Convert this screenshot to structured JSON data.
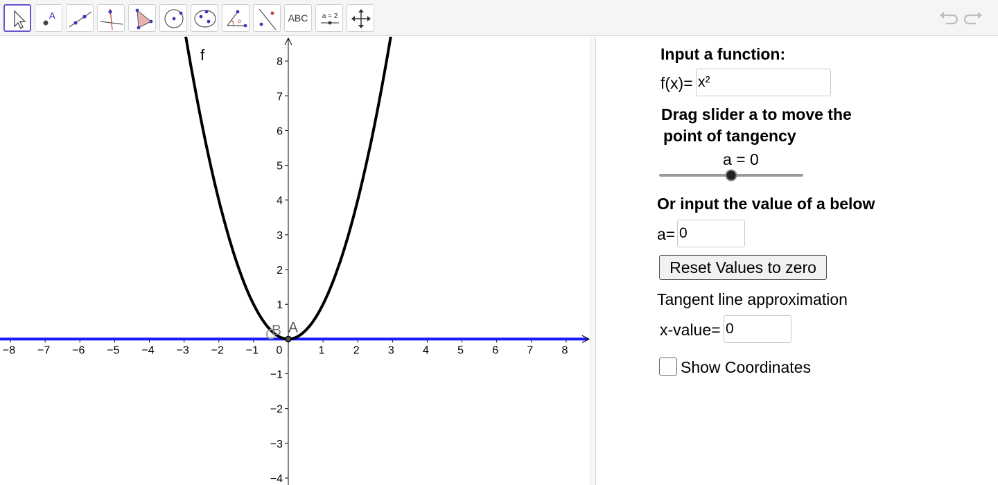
{
  "toolbar": {
    "tools": [
      {
        "name": "move-tool"
      },
      {
        "name": "point-tool",
        "glyph_label": "A"
      },
      {
        "name": "line-tool"
      },
      {
        "name": "perpendicular-line-tool"
      },
      {
        "name": "polygon-tool"
      },
      {
        "name": "circle-with-center-tool"
      },
      {
        "name": "ellipse-tool"
      },
      {
        "name": "angle-tool",
        "glyph_label": "α"
      },
      {
        "name": "reflect-tool"
      },
      {
        "name": "text-tool",
        "label": "ABC"
      },
      {
        "name": "slider-tool",
        "label": "a = 2"
      },
      {
        "name": "move-graphics-view-tool"
      }
    ],
    "undo_icon": "undo-icon",
    "redo_icon": "redo-icon"
  },
  "graph": {
    "function_label": "f",
    "point_labels": [
      "A",
      "B",
      "C"
    ],
    "x_ticks": [
      "−8",
      "−7",
      "−6",
      "−5",
      "−4",
      "−3",
      "−2",
      "−1",
      "0",
      "1",
      "2",
      "3",
      "4",
      "5",
      "6",
      "7",
      "8"
    ],
    "y_ticks": [
      "8",
      "7",
      "6",
      "5",
      "4",
      "3",
      "2",
      "1",
      "−1",
      "−2",
      "−3",
      "−4"
    ],
    "colors": {
      "curve": "#000000",
      "tangent": "#1a1aff",
      "axes": "#000000"
    }
  },
  "chart_data": {
    "type": "line",
    "title": "",
    "xlabel": "",
    "ylabel": "",
    "xlim": [
      -8.3,
      8.7
    ],
    "ylim": [
      -4.2,
      8.7
    ],
    "grid": false,
    "series": [
      {
        "name": "f",
        "function": "x²",
        "x": [
          -3,
          -2,
          -1,
          0,
          1,
          2,
          3
        ],
        "y": [
          9,
          4,
          1,
          0,
          1,
          4,
          9
        ]
      },
      {
        "name": "",
        "function": "y = 0",
        "x": [
          -8.3,
          8.7
        ],
        "y": [
          0,
          0
        ]
      }
    ],
    "points": [
      {
        "label": "A",
        "x": 0,
        "y": 0
      },
      {
        "label": "B",
        "x": 0,
        "y": 0
      },
      {
        "label": "C",
        "x": 0,
        "y": 0
      }
    ]
  },
  "panel": {
    "input_heading": "Input a function:",
    "fx_label": "f(x)=",
    "fx_value": "x²",
    "drag_heading_line1": "Drag slider a to move the",
    "drag_heading_line2": "point of tangency",
    "slider_label": "a = 0",
    "slider_value": 0,
    "or_heading": "Or input the value of a below",
    "a_label": "a=",
    "a_value": "0",
    "reset_button": "Reset Values to zero",
    "tangent_heading": "Tangent line approximation",
    "xvalue_label": "x-value=",
    "xvalue_value": "0",
    "show_coordinates_label": "Show Coordinates",
    "show_coordinates_checked": false
  }
}
